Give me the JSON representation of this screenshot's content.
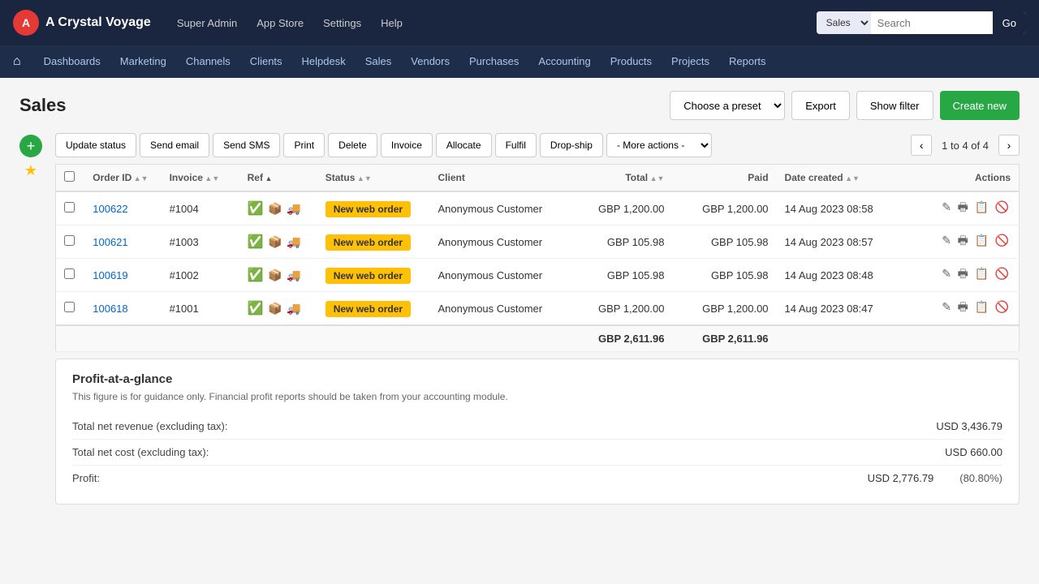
{
  "app": {
    "name": "A Crystal Voyage",
    "logo_text": "A"
  },
  "topbar": {
    "links": [
      "Super Admin",
      "App Store",
      "Settings",
      "Help"
    ],
    "search_placeholder": "Search",
    "search_context": "Sales",
    "go_label": "Go"
  },
  "secondary_nav": {
    "items": [
      "Dashboards",
      "Marketing",
      "Channels",
      "Clients",
      "Helpdesk",
      "Sales",
      "Vendors",
      "Purchases",
      "Accounting",
      "Products",
      "Projects",
      "Reports"
    ]
  },
  "page": {
    "title": "Sales",
    "preset_label": "Choose a preset",
    "export_label": "Export",
    "show_filter_label": "Show filter",
    "create_new_label": "Create new"
  },
  "toolbar": {
    "update_status": "Update status",
    "send_email": "Send email",
    "send_sms": "Send SMS",
    "print": "Print",
    "delete": "Delete",
    "invoice": "Invoice",
    "allocate": "Allocate",
    "fulfil": "Fulfil",
    "drop_ship": "Drop-ship",
    "more_actions": "- More actions -",
    "pagination_info": "1 to 4 of 4"
  },
  "table": {
    "columns": [
      "Order ID",
      "Invoice",
      "Ref",
      "Status",
      "Client",
      "Total",
      "Paid",
      "Date created",
      "Actions"
    ],
    "rows": [
      {
        "id": "100622",
        "invoice": "#1004",
        "ref": "",
        "status_badge": "New web order",
        "client": "Anonymous Customer",
        "total": "GBP 1,200.00",
        "paid": "GBP 1,200.00",
        "date": "14 Aug 2023 08:58"
      },
      {
        "id": "100621",
        "invoice": "#1003",
        "ref": "",
        "status_badge": "New web order",
        "client": "Anonymous Customer",
        "total": "GBP 105.98",
        "paid": "GBP 105.98",
        "date": "14 Aug 2023 08:57"
      },
      {
        "id": "100619",
        "invoice": "#1002",
        "ref": "",
        "status_badge": "New web order",
        "client": "Anonymous Customer",
        "total": "GBP 105.98",
        "paid": "GBP 105.98",
        "date": "14 Aug 2023 08:48"
      },
      {
        "id": "100618",
        "invoice": "#1001",
        "ref": "",
        "status_badge": "New web order",
        "client": "Anonymous Customer",
        "total": "GBP 1,200.00",
        "paid": "GBP 1,200.00",
        "date": "14 Aug 2023 08:47"
      }
    ],
    "totals": {
      "total": "GBP 2,611.96",
      "paid": "GBP 2,611.96"
    }
  },
  "profit": {
    "title": "Profit-at-a-glance",
    "subtitle": "This figure is for guidance only. Financial profit reports should be taken from your accounting module.",
    "rows": [
      {
        "label": "Total net revenue (excluding tax):",
        "value": "USD 3,436.79",
        "pct": ""
      },
      {
        "label": "Total net cost (excluding tax):",
        "value": "USD 660.00",
        "pct": ""
      },
      {
        "label": "Profit:",
        "value": "USD 2,776.79",
        "pct": "(80.80%)"
      }
    ]
  }
}
